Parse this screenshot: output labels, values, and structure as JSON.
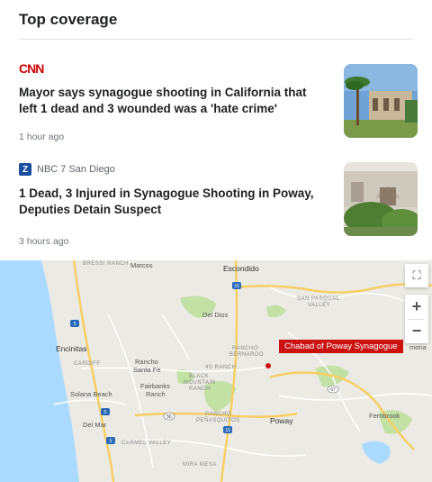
{
  "header": {
    "title": "Top coverage"
  },
  "articles": [
    {
      "source_logo": "CNN",
      "source_name": "",
      "headline": "Mayor says synagogue shooting in California that left 1 dead and 3 wounded was a 'hate crime'",
      "time": "1 hour ago"
    },
    {
      "source_logo": "Z",
      "source_name": "NBC 7 San Diego",
      "headline": "1 Dead, 3 Injured in Synagogue Shooting in Poway, Deputies Detain Suspect",
      "time": "3 hours ago"
    }
  ],
  "map": {
    "callout": "Chabad of Poway Synagogue",
    "labels": {
      "bressi_ranch": "BRESSI RANCH",
      "marcos": "Marcos",
      "escondido": "Escondido",
      "san_pasqual": "SAN PASQUAL",
      "valley": "VALLEY",
      "del_dios": "Del Dios",
      "encinitas": "Encinitas",
      "cardiff": "CARDIFF",
      "rancho_santa_fe_1": "Rancho",
      "rancho_santa_fe_2": "Santa Fe",
      "rancho_bernardo_1": "RANCHO",
      "rancho_bernardo_2": "BERNARDO",
      "four_s_ranch": "4S RANCH",
      "black_mountain_1": "BLACK",
      "black_mountain_2": "MOUNTAIN",
      "black_mountain_3": "RANCH",
      "fairbanks_1": "Fairbanks",
      "fairbanks_2": "Ranch",
      "solana_beach": "Solana Beach",
      "del_mar": "Del Mar",
      "rancho_penasquitos_1": "RANCHO",
      "rancho_penasquitos_2": "PEÑASQUITOS",
      "poway": "Poway",
      "fernbrook": "Fernbrook",
      "carmel_valley": "CARMEL VALLEY",
      "mira_mesa": "MIRA MESA",
      "ramona": "mona"
    },
    "route_shields": [
      "15",
      "5",
      "5",
      "5",
      "56",
      "15",
      "67"
    ],
    "controls": {
      "zoom_in": "+",
      "zoom_out": "−",
      "fullscreen": "⛶"
    }
  }
}
